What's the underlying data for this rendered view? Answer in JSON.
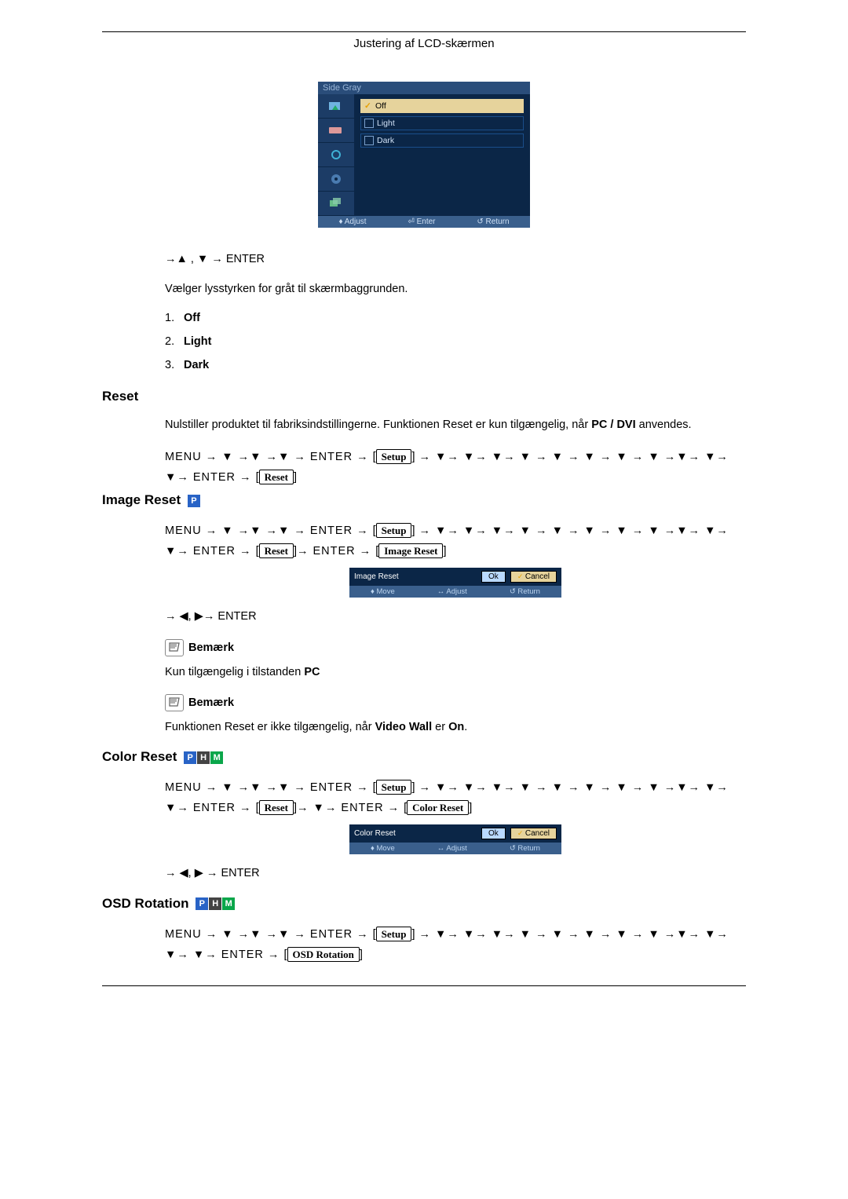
{
  "header": "Justering af LCD-skærmen",
  "side_gray_osd": {
    "title": "Side Gray",
    "options": [
      "Off",
      "Light",
      "Dark"
    ],
    "footer": {
      "adjust": "♦ Adjust",
      "enter": "⏎ Enter",
      "return": "↺ Return"
    }
  },
  "nav_line1": "→▲ , ▼ → ENTER",
  "desc_sidegray": "Vælger lysstyrken for gråt til skærmbaggrunden.",
  "list_items": [
    {
      "num": "1.",
      "label": "Off"
    },
    {
      "num": "2.",
      "label": "Light"
    },
    {
      "num": "3.",
      "label": "Dark"
    }
  ],
  "section_reset": "Reset",
  "reset_desc_pre": "Nulstiller produktet til fabriksindstillingerne. Funktionen Reset er kun tilgængelig, når ",
  "reset_desc_bold": "PC / DVI",
  "reset_desc_post": " anvendes.",
  "path_reset": {
    "pre": "MENU → ▼ →▼ →▼ → ENTER → ",
    "setup": "Setup",
    "mid": " → ▼→ ▼→ ▼→ ▼ → ▼ → ▼ → ▼ → ▼ →▼→ ▼→ ▼→ ENTER → ",
    "reset": "Reset"
  },
  "section_image_reset": "Image Reset",
  "path_image_reset": {
    "pre": "MENU → ▼ →▼ →▼ → ENTER → ",
    "setup": "Setup",
    "mid": " → ▼→ ▼→ ▼→ ▼ → ▼ → ▼ → ▼ → ▼ →▼→ ▼→ ▼→ ENTER → ",
    "reset": "Reset",
    "post": "→ ENTER → ",
    "image_reset": "Image Reset"
  },
  "mini_image": {
    "label": "Image Reset",
    "ok": "Ok",
    "cancel": "Cancel",
    "move": "♦ Move",
    "adjust": "↔ Adjust",
    "return": "↺ Return"
  },
  "nav_lr": "→ ◀, ▶→ ENTER",
  "note": "Bemærk",
  "only_pc_pre": "Kun tilgængelig i tilstanden ",
  "only_pc_bold": "PC",
  "reset_notavail_pre": "Funktionen Reset er ikke tilgængelig, når ",
  "reset_notavail_bold1": "Video Wall",
  "reset_notavail_mid": " er ",
  "reset_notavail_bold2": "On",
  "reset_notavail_post": ".",
  "section_color_reset": "Color Reset",
  "path_color_reset": {
    "pre": "MENU → ▼ →▼ →▼ → ENTER → ",
    "setup": "Setup",
    "mid": " → ▼→ ▼→ ▼→ ▼ → ▼ → ▼ → ▼ → ▼ →▼→ ▼→ ▼→ ENTER → ",
    "reset": "Reset",
    "post": "→ ▼→ ENTER → ",
    "color_reset": "Color Reset"
  },
  "mini_color": {
    "label": "Color Reset",
    "ok": "Ok",
    "cancel": "Cancel",
    "move": "♦ Move",
    "adjust": "↔ Adjust",
    "return": "↺ Return"
  },
  "nav_lr2": "→ ◀, ▶ → ENTER",
  "section_osd_rotation": "OSD Rotation",
  "path_osd_rotation": {
    "pre": "MENU → ▼ →▼ →▼ → ENTER → ",
    "setup": "Setup",
    "mid": " → ▼→ ▼→ ▼→ ▼ → ▼ → ▼ → ▼ → ▼ →▼→ ▼→ ▼→ ▼→ ENTER → ",
    "osd_rotation": "OSD Rotation"
  }
}
